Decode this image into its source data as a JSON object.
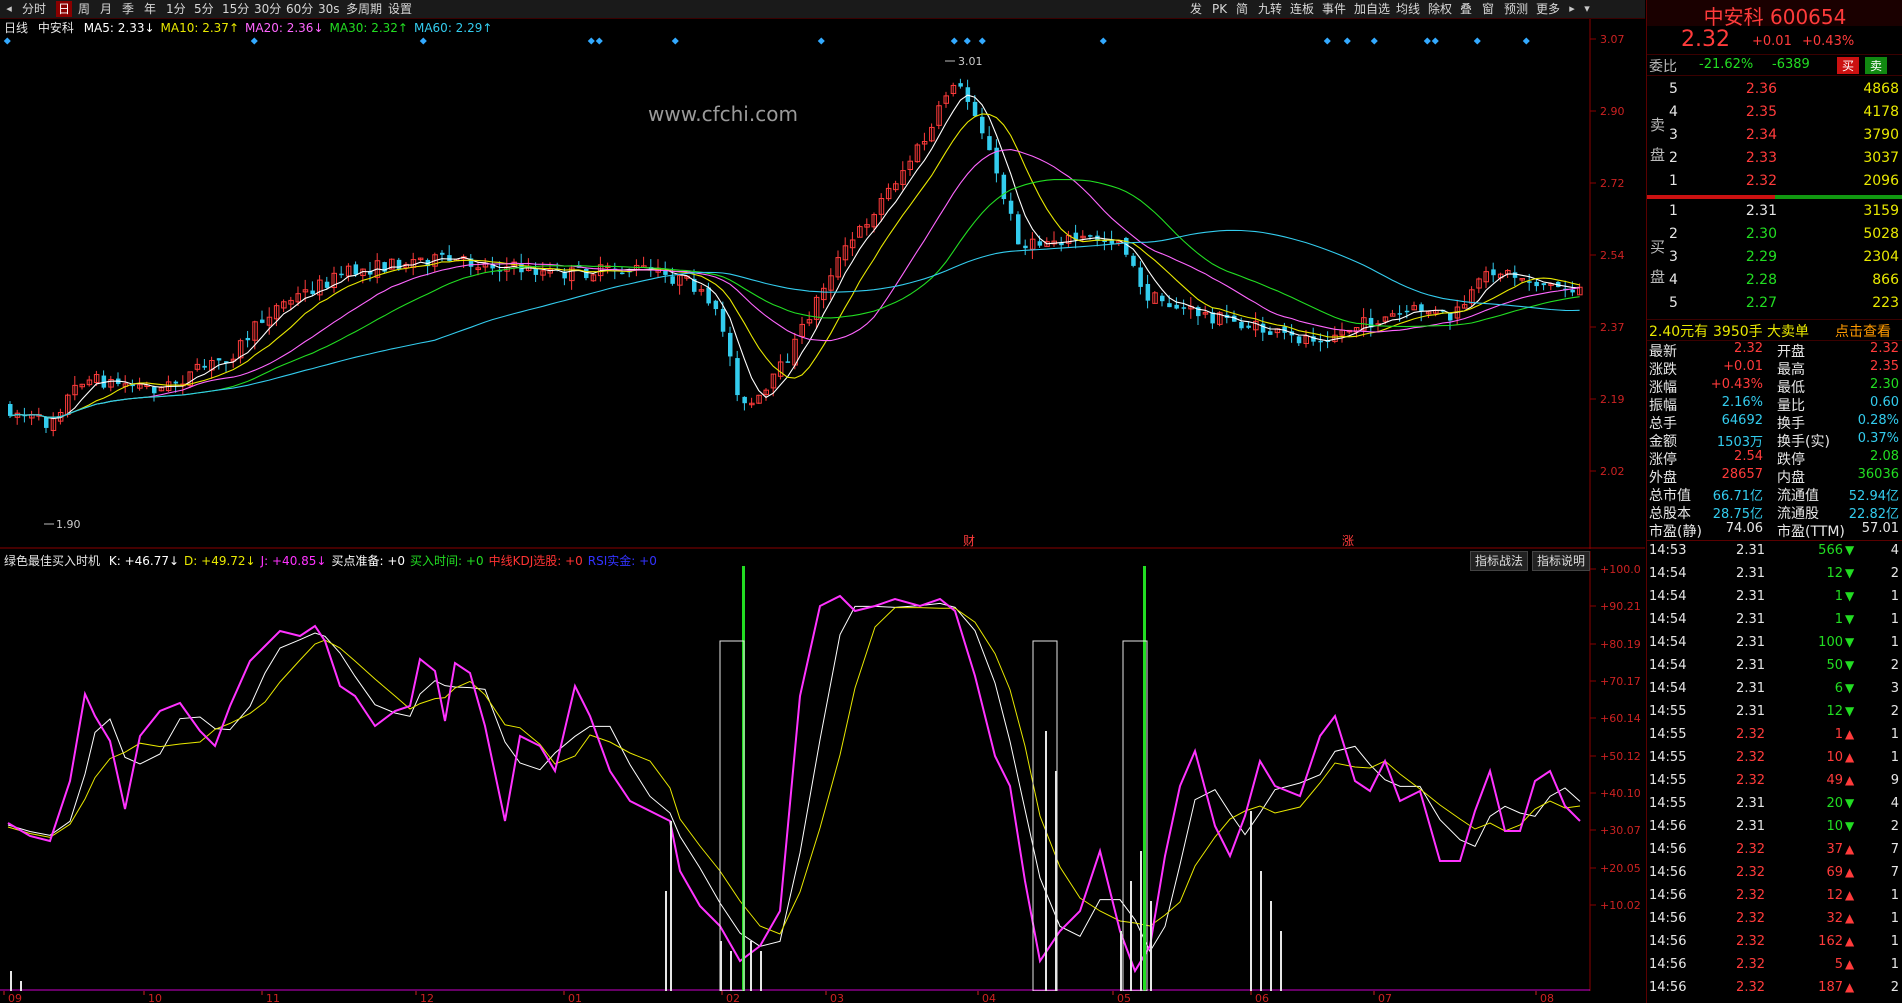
{
  "toolbar": {
    "left_items": [
      "分时",
      "日",
      "周",
      "月",
      "季",
      "年",
      "1分",
      "5分",
      "15分",
      "30分",
      "60分",
      "30s",
      "多周期",
      "设置"
    ],
    "active_item": "日",
    "right_items": [
      "发",
      "PK",
      "简",
      "九转",
      "连板",
      "事件",
      "加自选",
      "均线",
      "除权",
      "叠",
      "窗",
      "预测",
      "更多"
    ]
  },
  "main": {
    "period_label": "日线",
    "stock_name": "中安科",
    "ma": [
      {
        "label": "MA5: 2.33",
        "arrow": "↓",
        "color": "#ffffff"
      },
      {
        "label": "MA10: 2.37",
        "arrow": "↑",
        "color": "#e8e800"
      },
      {
        "label": "MA20: 2.36",
        "arrow": "↓",
        "color": "#ff66ff"
      },
      {
        "label": "MA30: 2.32",
        "arrow": "↑",
        "color": "#22dd22"
      },
      {
        "label": "MA60: 2.29",
        "arrow": "↑",
        "color": "#33ccee"
      }
    ],
    "watermark": "www.cfchi.com",
    "high_label": "3.01",
    "low_label": "1.90",
    "event_labels": [
      "财",
      "涨"
    ],
    "y_ticks": [
      "3.07",
      "2.90",
      "2.72",
      "2.54",
      "2.37",
      "2.19",
      "2.02"
    ]
  },
  "indicator": {
    "name": "绿色最佳买入时机",
    "items": [
      {
        "text": "K: +46.77↓",
        "color": "#ffffff"
      },
      {
        "text": "D: +49.72↓",
        "color": "#e8e800"
      },
      {
        "text": "J: +40.85↓",
        "color": "#ff33ff"
      },
      {
        "text": "买点准备: +0",
        "color": "#ffffff"
      },
      {
        "text": "买入时间: +0",
        "color": "#22dd22"
      },
      {
        "text": "中线KDJ选股: +0",
        "color": "#ff3333"
      },
      {
        "text": "RSI实金: +0",
        "color": "#3333ff"
      }
    ],
    "buttons": [
      "指标战法",
      "指标说明"
    ],
    "y_ticks": [
      "+100.0",
      "+90.21",
      "+80.19",
      "+70.17",
      "+60.14",
      "+50.12",
      "+40.10",
      "+30.07",
      "+20.05",
      "+10.02"
    ]
  },
  "x_months": [
    "09",
    "10",
    "11",
    "12",
    "01",
    "02",
    "03",
    "04",
    "05",
    "06",
    "07",
    "08"
  ],
  "quote": {
    "title": "中安科 600654",
    "price": "2.32",
    "change": "+0.01",
    "change_pct": "+0.43%",
    "weibi_label": "委比",
    "weibi_pct": "-21.62%",
    "weibi_val": "-6389",
    "buy_btn": "买",
    "sell_btn": "卖",
    "sell_label": [
      "卖",
      "盘"
    ],
    "buy_label": [
      "买",
      "盘"
    ],
    "asks": [
      {
        "level": "5",
        "price": "2.36",
        "vol": "4868"
      },
      {
        "level": "4",
        "price": "2.35",
        "vol": "4178"
      },
      {
        "level": "3",
        "price": "2.34",
        "vol": "3790"
      },
      {
        "level": "2",
        "price": "2.33",
        "vol": "3037"
      },
      {
        "level": "1",
        "price": "2.32",
        "vol": "2096"
      }
    ],
    "bids": [
      {
        "level": "1",
        "price": "2.31",
        "vol": "3159",
        "color": "white"
      },
      {
        "level": "2",
        "price": "2.30",
        "vol": "5028",
        "color": "green"
      },
      {
        "level": "3",
        "price": "2.29",
        "vol": "2304",
        "color": "green"
      },
      {
        "level": "4",
        "price": "2.28",
        "vol": "866",
        "color": "green"
      },
      {
        "level": "5",
        "price": "2.27",
        "vol": "223",
        "color": "green"
      }
    ],
    "bigorder": {
      "price": "2.40元有",
      "hands": "3950手",
      "label": "大卖单",
      "link": "点击查看"
    },
    "stats": [
      [
        "最新",
        "2.32",
        "red",
        "开盘",
        "2.32",
        "red"
      ],
      [
        "涨跌",
        "+0.01",
        "red",
        "最高",
        "2.35",
        "red"
      ],
      [
        "涨幅",
        "+0.43%",
        "red",
        "最低",
        "2.30",
        "green"
      ],
      [
        "振幅",
        "2.16%",
        "cyan",
        "量比",
        "0.60",
        "cyan"
      ],
      [
        "总手",
        "64692",
        "cyan",
        "换手",
        "0.28%",
        "cyan"
      ],
      [
        "金额",
        "1503万",
        "cyan",
        "换手(实)",
        "0.37%",
        "cyan"
      ],
      [
        "涨停",
        "2.54",
        "red",
        "跌停",
        "2.08",
        "green"
      ],
      [
        "外盘",
        "28657",
        "red",
        "内盘",
        "36036",
        "green"
      ],
      [
        "总市值",
        "66.71亿",
        "cyan",
        "流通值",
        "52.94亿",
        "cyan"
      ],
      [
        "总股本",
        "28.75亿",
        "cyan",
        "流通股",
        "22.82亿",
        "cyan"
      ],
      [
        "市盈(静)",
        "74.06",
        "white",
        "市盈(TTM)",
        "57.01",
        "white"
      ]
    ],
    "ticks": [
      {
        "time": "14:53",
        "price": "2.31",
        "vol": "566",
        "dir": "down",
        "n": "4"
      },
      {
        "time": "14:54",
        "price": "2.31",
        "vol": "12",
        "dir": "down",
        "n": "2"
      },
      {
        "time": "14:54",
        "price": "2.31",
        "vol": "1",
        "dir": "down",
        "n": "1"
      },
      {
        "time": "14:54",
        "price": "2.31",
        "vol": "1",
        "dir": "down",
        "n": "1"
      },
      {
        "time": "14:54",
        "price": "2.31",
        "vol": "100",
        "dir": "down",
        "n": "1"
      },
      {
        "time": "14:54",
        "price": "2.31",
        "vol": "50",
        "dir": "down",
        "n": "2"
      },
      {
        "time": "14:54",
        "price": "2.31",
        "vol": "6",
        "dir": "down",
        "n": "3"
      },
      {
        "time": "14:55",
        "price": "2.31",
        "vol": "12",
        "dir": "down",
        "n": "2"
      },
      {
        "time": "14:55",
        "price": "2.32",
        "vol": "1",
        "dir": "up",
        "n": "1"
      },
      {
        "time": "14:55",
        "price": "2.32",
        "vol": "10",
        "dir": "up",
        "n": "1"
      },
      {
        "time": "14:55",
        "price": "2.32",
        "vol": "49",
        "dir": "up",
        "n": "9"
      },
      {
        "time": "14:55",
        "price": "2.31",
        "vol": "20",
        "dir": "down",
        "n": "4"
      },
      {
        "time": "14:56",
        "price": "2.31",
        "vol": "10",
        "dir": "down",
        "n": "2"
      },
      {
        "time": "14:56",
        "price": "2.32",
        "vol": "37",
        "dir": "up",
        "n": "7"
      },
      {
        "time": "14:56",
        "price": "2.32",
        "vol": "69",
        "dir": "up",
        "n": "7"
      },
      {
        "time": "14:56",
        "price": "2.32",
        "vol": "12",
        "dir": "up",
        "n": "1"
      },
      {
        "time": "14:56",
        "price": "2.32",
        "vol": "32",
        "dir": "up",
        "n": "1"
      },
      {
        "time": "14:56",
        "price": "2.32",
        "vol": "162",
        "dir": "up",
        "n": "1"
      },
      {
        "time": "14:56",
        "price": "2.32",
        "vol": "5",
        "dir": "up",
        "n": "1"
      },
      {
        "time": "14:56",
        "price": "2.32",
        "vol": "187",
        "dir": "up",
        "n": "2"
      }
    ]
  }
}
